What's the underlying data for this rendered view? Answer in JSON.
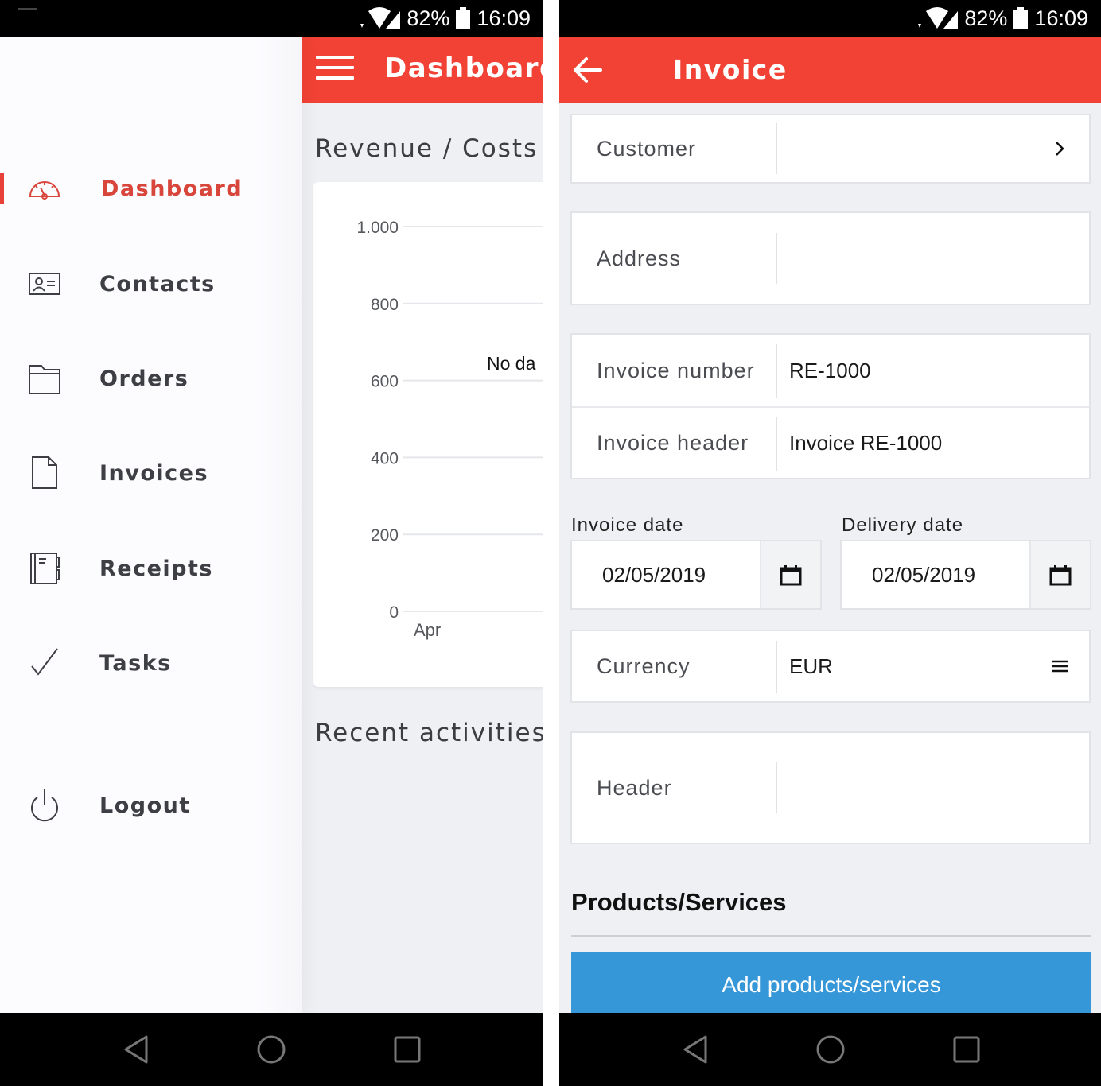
{
  "status_bar": {
    "battery": "82%",
    "time": "16:09"
  },
  "left_screen": {
    "toolbar": {
      "title": "Dashboard",
      "menu_icon": "hamburger-menu-icon"
    },
    "drawer": {
      "items": [
        {
          "label": "Dashboard",
          "icon": "speedometer-icon",
          "active": true
        },
        {
          "label": "Contacts",
          "icon": "contact-card-icon",
          "active": false
        },
        {
          "label": "Orders",
          "icon": "folder-icon",
          "active": false
        },
        {
          "label": "Invoices",
          "icon": "document-icon",
          "active": false
        },
        {
          "label": "Receipts",
          "icon": "notebook-icon",
          "active": false
        },
        {
          "label": "Tasks",
          "icon": "checkmark-icon",
          "active": false
        },
        {
          "label": "Logout",
          "icon": "power-icon",
          "active": false
        }
      ]
    },
    "dashboard": {
      "revenue_title": "Revenue / Costs",
      "recent_title": "Recent activities"
    }
  },
  "chart_data": {
    "type": "bar",
    "title": "Revenue / Costs",
    "categories": [
      "Apr"
    ],
    "series": [],
    "yticks": [
      "0",
      "200",
      "400",
      "600",
      "800",
      "1.000"
    ],
    "ytick_values": [
      0,
      200,
      400,
      600,
      800,
      1000
    ],
    "ylim": [
      0,
      1000
    ],
    "grid": true,
    "no_data_text": "No da",
    "xlabel": "",
    "ylabel": ""
  },
  "right_screen": {
    "toolbar": {
      "title": "Invoice",
      "back_icon": "arrow-left-icon"
    },
    "fields": {
      "customer": {
        "label": "Customer",
        "value": ""
      },
      "address": {
        "label": "Address",
        "value": ""
      },
      "invoice_number": {
        "label": "Invoice number",
        "value": "RE-1000"
      },
      "invoice_header": {
        "label": "Invoice header",
        "value": "Invoice RE-1000"
      },
      "currency": {
        "label": "Currency",
        "value": "EUR"
      },
      "header": {
        "label": "Header",
        "value": ""
      }
    },
    "dates": {
      "invoice_date": {
        "label": "Invoice date",
        "value": "02/05/2019"
      },
      "delivery_date": {
        "label": "Delivery date",
        "value": "02/05/2019"
      }
    },
    "products": {
      "title": "Products/Services",
      "add_button": "Add products/services"
    }
  },
  "colors": {
    "accent_red": "#f14235",
    "active_item_red": "#d8453b",
    "button_blue": "#3596d8"
  }
}
